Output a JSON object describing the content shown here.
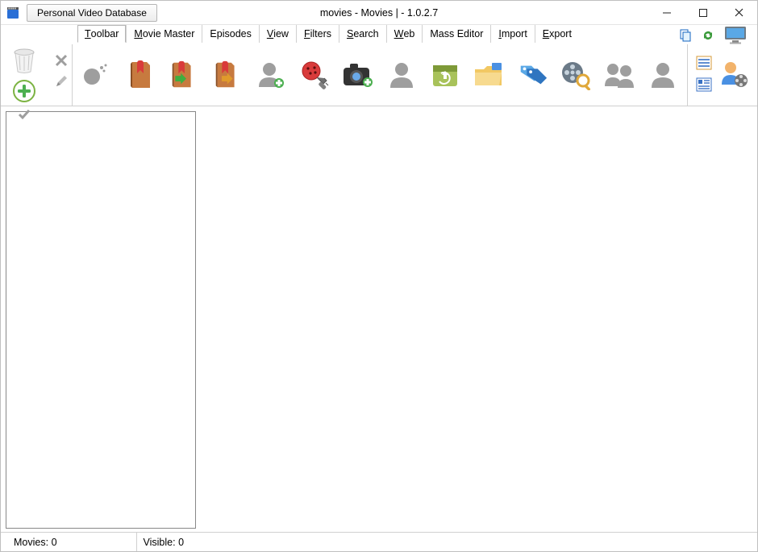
{
  "titlebar": {
    "app_button": "Personal Video Database",
    "window_title": "movies - Movies | - 1.0.2.7"
  },
  "menu": {
    "items": [
      {
        "label": "Toolbar",
        "mnemonic_index": 0,
        "active": true
      },
      {
        "label": "Movie Master",
        "mnemonic_index": 0
      },
      {
        "label": "Episodes",
        "mnemonic_index": -1
      },
      {
        "label": "View",
        "mnemonic_index": 0
      },
      {
        "label": "Filters",
        "mnemonic_index": 0
      },
      {
        "label": "Search",
        "mnemonic_index": 0
      },
      {
        "label": "Web",
        "mnemonic_index": 0
      },
      {
        "label": "Mass Editor",
        "mnemonic_index": -1
      },
      {
        "label": "Import",
        "mnemonic_index": 0
      },
      {
        "label": "Export",
        "mnemonic_index": 0
      }
    ]
  },
  "toolbar_left": {
    "trash_icon": "recycle-bin",
    "unknown_x_icon": "delete-x",
    "add_icon": "add",
    "check_icon": "confirm-check",
    "pencil_icon": "edit-pencil"
  },
  "toolbar_main_icons": [
    "spray-icon",
    "book-icon",
    "book-down-icon",
    "book-right-icon",
    "person-plus-icon",
    "bug-plug-icon",
    "camera-plus-icon",
    "person-icon",
    "recycle-box-icon",
    "folder-tab-icon",
    "tags-icon",
    "film-search-icon",
    "people-group-icon",
    "person-silhouette-icon"
  ],
  "menubar_right_icons": [
    "copy-icon",
    "refresh-icon",
    "monitor-icon"
  ],
  "toolbar_right_icons": [
    "list-icon",
    "user-film-icon"
  ],
  "statusbar": {
    "movies_label": "Movies:",
    "movies_value": "0",
    "visible_label": "Visible:",
    "visible_value": "0"
  }
}
